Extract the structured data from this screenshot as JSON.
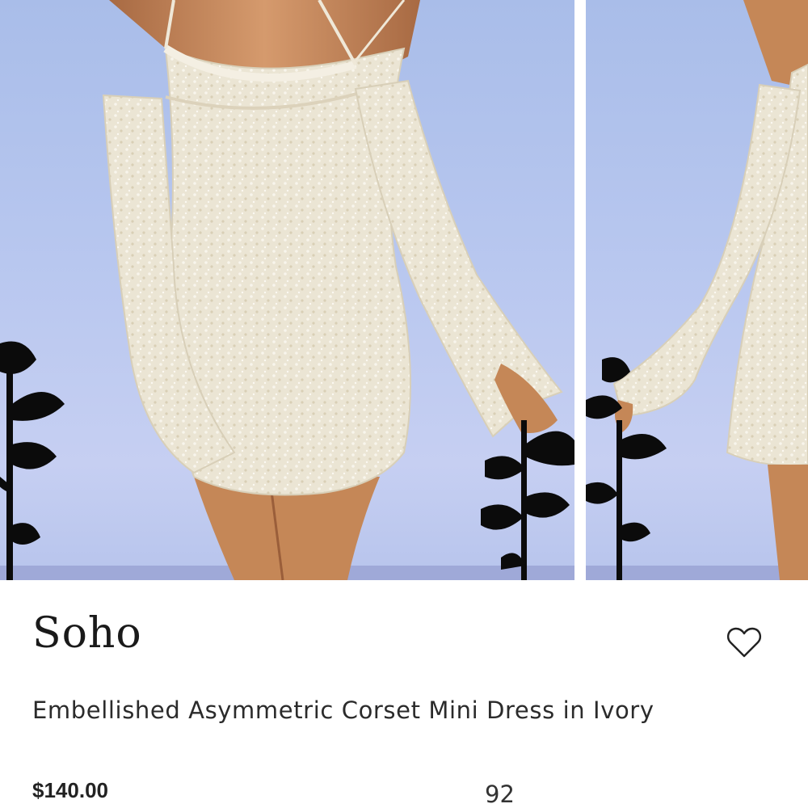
{
  "product": {
    "brand": "Soho",
    "title": "Embellished Asymmetric Corset Mini Dress in Ivory",
    "price": "$140.00",
    "count": "92",
    "favorite_icon": "heart-outline-icon"
  },
  "colors": {
    "backdrop_blue": "#b8c7ef",
    "dress_ivory": "#ece6d6",
    "skin": "#c88a5f",
    "silhouette": "#0b0b0b",
    "text": "#1a1a1a"
  }
}
